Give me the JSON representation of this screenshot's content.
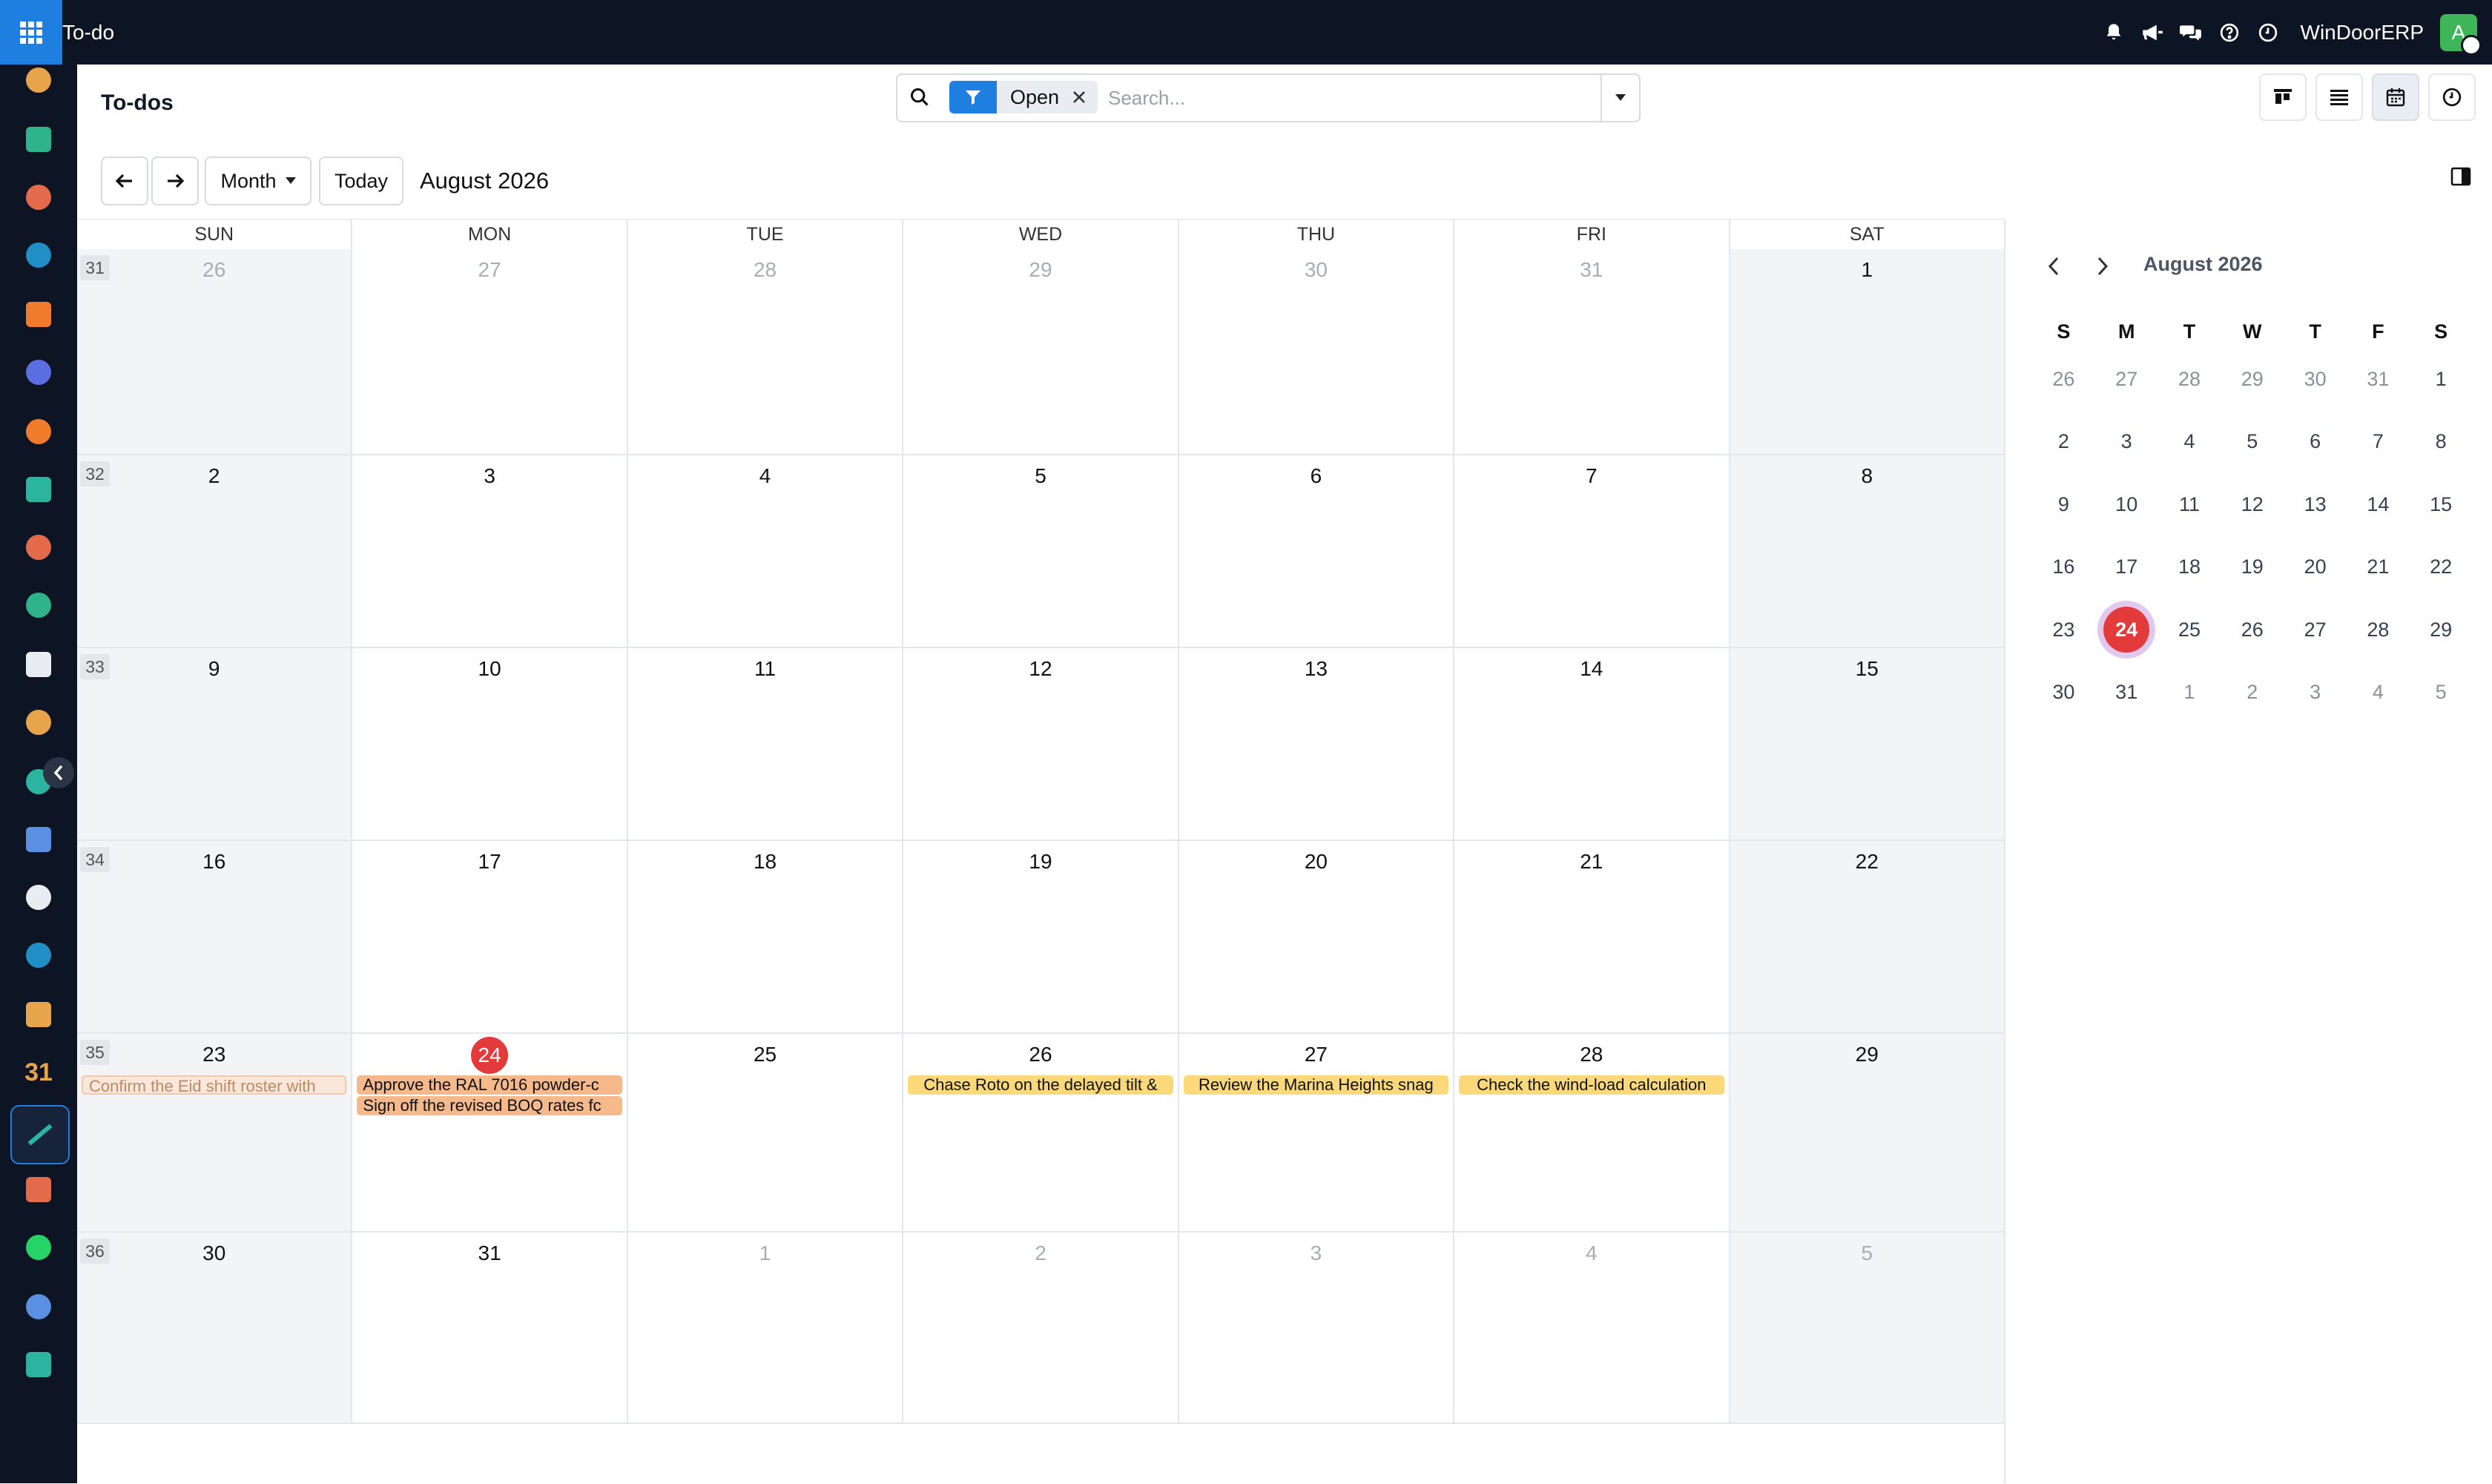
{
  "app": {
    "title": "To-do",
    "company": "WinDoorERP",
    "avatar_initial": "A"
  },
  "topbar": {
    "icons": [
      "bell-icon",
      "megaphone-icon",
      "chat-icon",
      "help-icon",
      "clock-icon"
    ]
  },
  "rail": {
    "apps": [
      {
        "name": "sales-app",
        "color": "#e8a44a"
      },
      {
        "name": "contacts-app",
        "color": "#2fb38a"
      },
      {
        "name": "reporting-app",
        "color": "#e36b4b"
      },
      {
        "name": "dashboard-app",
        "color": "#1f8fc6"
      },
      {
        "name": "discuss-app",
        "color": "#f07c2b"
      },
      {
        "name": "email-marketing-app",
        "color": "#5b6ee1"
      },
      {
        "name": "livechat-app",
        "color": "#f07c2b"
      },
      {
        "name": "project-app",
        "color": "#2bb5a0"
      },
      {
        "name": "analytics-app",
        "color": "#e36b4b"
      },
      {
        "name": "employees-app",
        "color": "#2fb38a"
      },
      {
        "name": "inventory-app",
        "color": "#e9edf2"
      },
      {
        "name": "crm-app",
        "color": "#e8a44a"
      },
      {
        "name": "tasks-app",
        "color": "#2bb5a0"
      },
      {
        "name": "knowledge-app",
        "color": "#5b8fe1"
      },
      {
        "name": "purchase-app",
        "color": "#e9edf2"
      },
      {
        "name": "invoicing-app",
        "color": "#1f8fc6"
      },
      {
        "name": "team-app",
        "color": "#e8a44a"
      },
      {
        "name": "calendar-app",
        "label": "31",
        "color": "#e8a44a"
      },
      {
        "name": "todo-app",
        "color": "#2bb5a0"
      },
      {
        "name": "spreadsheet-app",
        "color": "#e36b4b"
      },
      {
        "name": "whatsapp-app",
        "color": "#25d366"
      },
      {
        "name": "timesheet-app",
        "color": "#5b8fe1"
      },
      {
        "name": "website-app",
        "color": "#2bb5a0"
      }
    ]
  },
  "control_panel": {
    "title": "To-dos",
    "facet_label": "Open",
    "search_placeholder": "Search..."
  },
  "toolbar": {
    "scale_label": "Month",
    "today_label": "Today",
    "title": "August 2026"
  },
  "calendar": {
    "day_names": [
      "SUN",
      "MON",
      "TUE",
      "WED",
      "THU",
      "FRI",
      "SAT"
    ],
    "weeks": [
      {
        "number": "31",
        "days": [
          {
            "d": "26",
            "other": true
          },
          {
            "d": "27",
            "other": true
          },
          {
            "d": "28",
            "other": true
          },
          {
            "d": "29",
            "other": true
          },
          {
            "d": "30",
            "other": true
          },
          {
            "d": "31",
            "other": true
          },
          {
            "d": "1"
          }
        ]
      },
      {
        "number": "32",
        "days": [
          {
            "d": "2"
          },
          {
            "d": "3"
          },
          {
            "d": "4"
          },
          {
            "d": "5"
          },
          {
            "d": "6"
          },
          {
            "d": "7"
          },
          {
            "d": "8"
          }
        ]
      },
      {
        "number": "33",
        "days": [
          {
            "d": "9"
          },
          {
            "d": "10"
          },
          {
            "d": "11"
          },
          {
            "d": "12"
          },
          {
            "d": "13"
          },
          {
            "d": "14"
          },
          {
            "d": "15"
          }
        ]
      },
      {
        "number": "34",
        "days": [
          {
            "d": "16"
          },
          {
            "d": "17"
          },
          {
            "d": "18"
          },
          {
            "d": "19"
          },
          {
            "d": "20"
          },
          {
            "d": "21"
          },
          {
            "d": "22"
          }
        ]
      },
      {
        "number": "35",
        "days": [
          {
            "d": "23",
            "events": [
              {
                "title": "Confirm the Eid shift roster with",
                "style": "faded"
              }
            ]
          },
          {
            "d": "24",
            "today": true,
            "events": [
              {
                "title": "Approve the RAL 7016 powder-c",
                "style": "orange"
              },
              {
                "title": "Sign off the revised BOQ rates fc",
                "style": "orange"
              }
            ]
          },
          {
            "d": "25"
          },
          {
            "d": "26",
            "events": [
              {
                "title": "Chase Roto on the delayed tilt &",
                "style": "yellow"
              }
            ]
          },
          {
            "d": "27",
            "events": [
              {
                "title": "Review the Marina Heights snag",
                "style": "yellow"
              }
            ]
          },
          {
            "d": "28",
            "events": [
              {
                "title": "Check the wind-load calculation",
                "style": "yellow"
              }
            ]
          },
          {
            "d": "29"
          }
        ]
      },
      {
        "number": "36",
        "days": [
          {
            "d": "30"
          },
          {
            "d": "31"
          },
          {
            "d": "1",
            "other": true
          },
          {
            "d": "2",
            "other": true
          },
          {
            "d": "3",
            "other": true
          },
          {
            "d": "4",
            "other": true
          },
          {
            "d": "5",
            "other": true
          }
        ]
      }
    ]
  },
  "mini_calendar": {
    "title": "August 2026",
    "day_initials": [
      "S",
      "M",
      "T",
      "W",
      "T",
      "F",
      "S"
    ],
    "weeks": [
      [
        {
          "d": "26",
          "other": true
        },
        {
          "d": "27",
          "other": true
        },
        {
          "d": "28",
          "other": true
        },
        {
          "d": "29",
          "other": true
        },
        {
          "d": "30",
          "other": true
        },
        {
          "d": "31",
          "other": true
        },
        {
          "d": "1"
        }
      ],
      [
        {
          "d": "2"
        },
        {
          "d": "3"
        },
        {
          "d": "4"
        },
        {
          "d": "5"
        },
        {
          "d": "6"
        },
        {
          "d": "7"
        },
        {
          "d": "8"
        }
      ],
      [
        {
          "d": "9"
        },
        {
          "d": "10"
        },
        {
          "d": "11"
        },
        {
          "d": "12"
        },
        {
          "d": "13"
        },
        {
          "d": "14"
        },
        {
          "d": "15"
        }
      ],
      [
        {
          "d": "16"
        },
        {
          "d": "17"
        },
        {
          "d": "18"
        },
        {
          "d": "19"
        },
        {
          "d": "20"
        },
        {
          "d": "21"
        },
        {
          "d": "22"
        }
      ],
      [
        {
          "d": "23"
        },
        {
          "d": "24",
          "today": true
        },
        {
          "d": "25"
        },
        {
          "d": "26"
        },
        {
          "d": "27"
        },
        {
          "d": "28"
        },
        {
          "d": "29"
        }
      ],
      [
        {
          "d": "30"
        },
        {
          "d": "31"
        },
        {
          "d": "1",
          "other": true
        },
        {
          "d": "2",
          "other": true
        },
        {
          "d": "3",
          "other": true
        },
        {
          "d": "4",
          "other": true
        },
        {
          "d": "5",
          "other": true
        }
      ]
    ]
  },
  "colors": {
    "topbar_bg": "#0d1524",
    "accent": "#1f7fe1",
    "today": "#e33b3b",
    "event_orange": "#f6b98c",
    "event_yellow": "#fbd97a"
  }
}
